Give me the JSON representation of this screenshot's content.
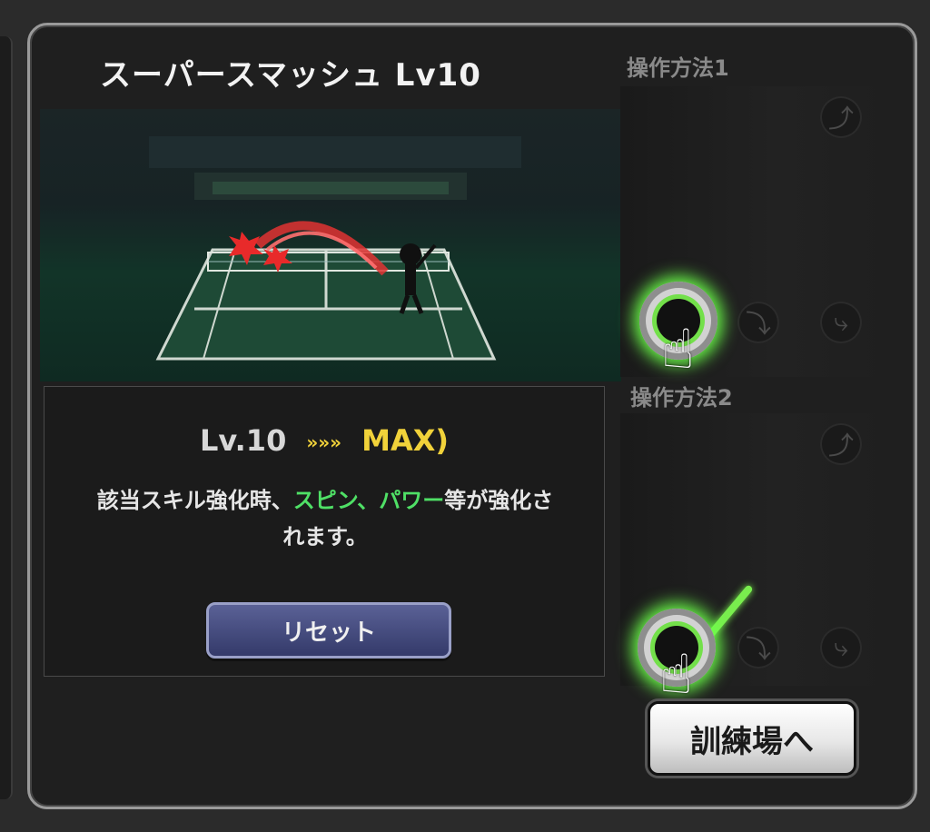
{
  "skill": {
    "title": "スーパースマッシュ Lv10"
  },
  "level": {
    "current": "Lv.10",
    "arrows": "»»»",
    "max": "MAX)"
  },
  "description": {
    "prefix": "該当スキル強化時、",
    "highlight": "スピン、パワー",
    "suffix": "等が強化さ",
    "line2": "れます。"
  },
  "buttons": {
    "reset": "リセット",
    "training": "訓練場へ"
  },
  "controls": {
    "method1": "操作方法1",
    "method2": "操作方法2"
  },
  "colors": {
    "accent_green": "#4fe066",
    "max_yellow": "#f1d23a",
    "reset_blue": "#3d4478"
  },
  "icons": {
    "gesture_hand": "pointing-hand-icon",
    "swipe_arc": "swipe-arc-icon",
    "swipe_curve": "swipe-curve-icon",
    "swipe_diagonal": "swipe-diagonal-icon"
  }
}
